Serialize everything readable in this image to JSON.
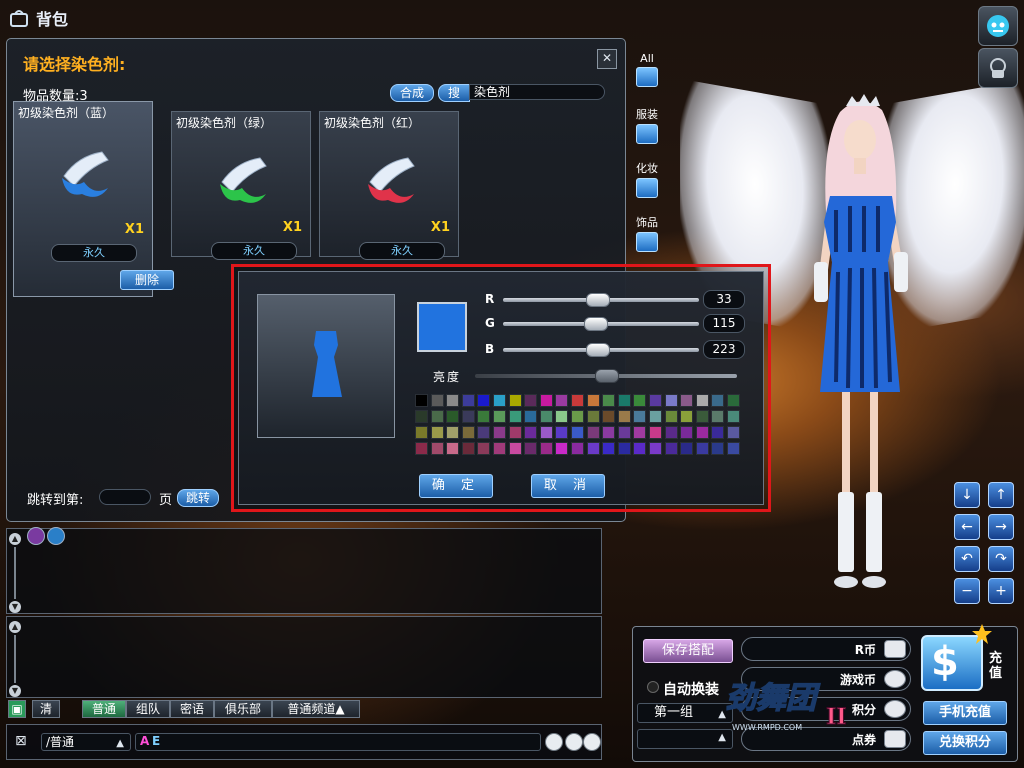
{
  "window": {
    "title": "背包"
  },
  "inventory": {
    "heading": "请选择染色剂:",
    "item_count_label": "物品数量:3",
    "compose_label": "合成",
    "search_label": "搜",
    "search_value": "染色剂",
    "items": [
      {
        "name": "初级染色剂（蓝）",
        "qty": "X1",
        "duration": "永久",
        "color": "#2a7fe0"
      },
      {
        "name": "初级染色剂（绿）",
        "qty": "X1",
        "duration": "永久",
        "color": "#2cc44a"
      },
      {
        "name": "初级染色剂（红）",
        "qty": "X1",
        "duration": "永久",
        "color": "#e0334a"
      }
    ],
    "delete_label": "删除",
    "jump_label": "跳转到第:",
    "page_label": "页",
    "jump_button": "跳转",
    "categories": [
      {
        "label": "All"
      },
      {
        "label": "服装"
      },
      {
        "label": "化妆"
      },
      {
        "label": "饰品"
      }
    ]
  },
  "dye": {
    "current_color": "#2173df",
    "channels": [
      {
        "label": "R",
        "value": "33",
        "fraction": 0.48
      },
      {
        "label": "G",
        "value": "115",
        "fraction": 0.47
      },
      {
        "label": "B",
        "value": "223",
        "fraction": 0.48
      }
    ],
    "brightness_label": "亮度",
    "brightness_fraction": 0.5,
    "palette_rows": [
      [
        "#000000",
        "#5a5a5a",
        "#8a8a8a",
        "#3c3c9a",
        "#1a1acd",
        "#2aa0c8",
        "#a8a800",
        "#5a2a5a",
        "#c81aa0",
        "#9a3aa0",
        "#c83a3a",
        "#c8783a",
        "#4a8a4a",
        "#1a7a6a",
        "#3a8a3a",
        "#5a3aa0",
        "#7a7ac8",
        "#8a5a8a",
        "#aaaaaa",
        "#3a6a8a",
        "#2a6a3a"
      ],
      [
        "#2a3a2a",
        "#4a6a4a",
        "#2a5a2a",
        "#3a3a5a",
        "#3a7a3a",
        "#5a9a5a",
        "#3a9a7a",
        "#2a6a9a",
        "#4a8a6a",
        "#8ac88a",
        "#6a9a4a",
        "#6a7a3a",
        "#6a4a2a",
        "#9a7a4a",
        "#4a7a9a",
        "#6aa0a0",
        "#6a8a3a",
        "#8aa03a",
        "#3a5a3a",
        "#5a7a6a",
        "#4a8a7a"
      ],
      [
        "#7a7a2a",
        "#9a9a4a",
        "#a0a06a",
        "#7a6a3a",
        "#4a3a7a",
        "#8a3a8a",
        "#a03a6a",
        "#6a2a9a",
        "#9a5ac8",
        "#5a3ac8",
        "#3a5ac8",
        "#7a3a7a",
        "#8a3aa0",
        "#6a3a9a",
        "#a03aa0",
        "#c83a8a",
        "#5a2a8a",
        "#7a2a9a",
        "#9a2aa0",
        "#3a2a9a",
        "#5a5aa0"
      ],
      [
        "#8a2a4a",
        "#a04a6a",
        "#c86a8a",
        "#6a2a3a",
        "#8a3a5a",
        "#a03a7a",
        "#c84aa0",
        "#6a2a6a",
        "#9a2a8a",
        "#c82ac8",
        "#8a2aa0",
        "#6a3ac8",
        "#3a2ac8",
        "#2a2aa0",
        "#5a2ac8",
        "#7a3ac8",
        "#4a2a9a",
        "#2a2a8a",
        "#3a3aa0",
        "#2a3a8a",
        "#3a4aa0"
      ]
    ],
    "ok_label": "确 定",
    "cancel_label": "取 消"
  },
  "chat": {
    "tabs": [
      {
        "label": "清",
        "active": false
      },
      {
        "label": "普通",
        "active": true
      },
      {
        "label": "组队",
        "active": false
      },
      {
        "label": "密语",
        "active": false
      },
      {
        "label": "俱乐部",
        "active": false
      },
      {
        "label": "普通频道▲",
        "active": false
      }
    ],
    "channel_value": "/普通",
    "format_a": "A",
    "format_e": "E"
  },
  "wallet": {
    "save_outfit": "保存搭配",
    "rcoin_label": "R币",
    "gamecoin_label": "游戏币",
    "points_label": "积分",
    "vouchers_label": "点券",
    "auto_swap": "自动换装",
    "group_value": "第一组",
    "recharge_label": "充值",
    "mobile_recharge": "手机充值",
    "exchange_points": "兑换积分"
  },
  "logo": {
    "text": "劲舞团",
    "roman": "II",
    "url_text": "WWW.RMPD.COM"
  },
  "colors": {
    "accent_blue": "#1c5ea8",
    "highlight_red": "#e0161a",
    "heading_orange": "#ffb020",
    "qty_yellow": "#ffd21f"
  }
}
